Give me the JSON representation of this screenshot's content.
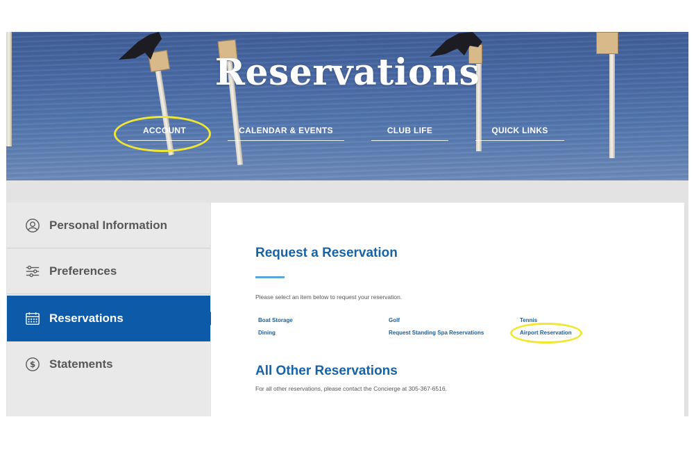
{
  "hero": {
    "title": "Reservations",
    "nav": [
      {
        "label": "ACCOUNT",
        "highlighted": true
      },
      {
        "label": "CALENDAR & EVENTS"
      },
      {
        "label": "CLUB LIFE"
      },
      {
        "label": "QUICK LINKS"
      }
    ]
  },
  "sidebar": {
    "items": [
      {
        "label": "Personal Information",
        "icon": "user-circle-icon"
      },
      {
        "label": "Preferences",
        "icon": "sliders-icon"
      },
      {
        "label": "Reservations",
        "icon": "calendar-icon",
        "active": true
      },
      {
        "label": "Statements",
        "icon": "dollar-circle-icon"
      }
    ]
  },
  "main": {
    "request_heading": "Request a Reservation",
    "intro": "Please select an item below to request your reservation.",
    "links": [
      {
        "label": "Boat Storage"
      },
      {
        "label": "Golf"
      },
      {
        "label": "Tennis"
      },
      {
        "label": "Dining"
      },
      {
        "label": "Request Standing Spa Reservations"
      },
      {
        "label": "Airport Reservation",
        "highlighted": true
      }
    ],
    "other_heading": "All Other Reservations",
    "other_note": "For all other reservations, please contact the Concierge at 305-367-6516."
  },
  "colors": {
    "brand_blue": "#0c5aa8",
    "heading_blue": "#1863a5",
    "accent_line": "#58a8de",
    "highlight_yellow": "#f1e733",
    "sidebar_bg": "#e9e9e9"
  }
}
